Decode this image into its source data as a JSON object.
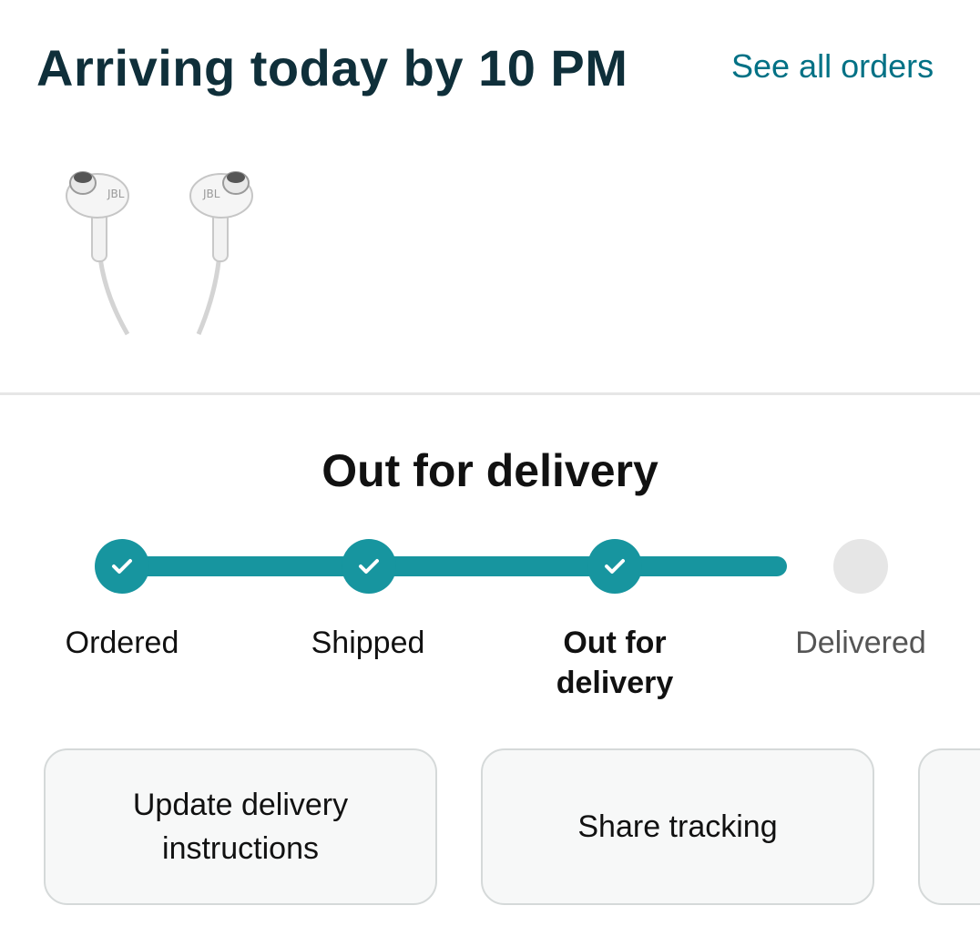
{
  "header": {
    "title": "Arriving today by 10 PM",
    "see_all_orders": "See all orders"
  },
  "product": {
    "image": "jbl-white-in-ear-earphones",
    "image_text": "JBL"
  },
  "status": {
    "title": "Out for delivery",
    "steps": [
      {
        "label": "Ordered",
        "state": "done"
      },
      {
        "label": "Shipped",
        "state": "done"
      },
      {
        "label": "Out for\ndelivery",
        "state": "current"
      },
      {
        "label": "Delivered",
        "state": "pending"
      }
    ],
    "progress_fraction": 0.9
  },
  "actions": [
    {
      "label": "Update delivery\ninstructions"
    },
    {
      "label": "Share tracking"
    },
    {
      "label": ""
    }
  ],
  "colors": {
    "accent": "#17959f",
    "link": "#007185",
    "title": "#0f2f3a",
    "pending": "#e6e6e6"
  }
}
